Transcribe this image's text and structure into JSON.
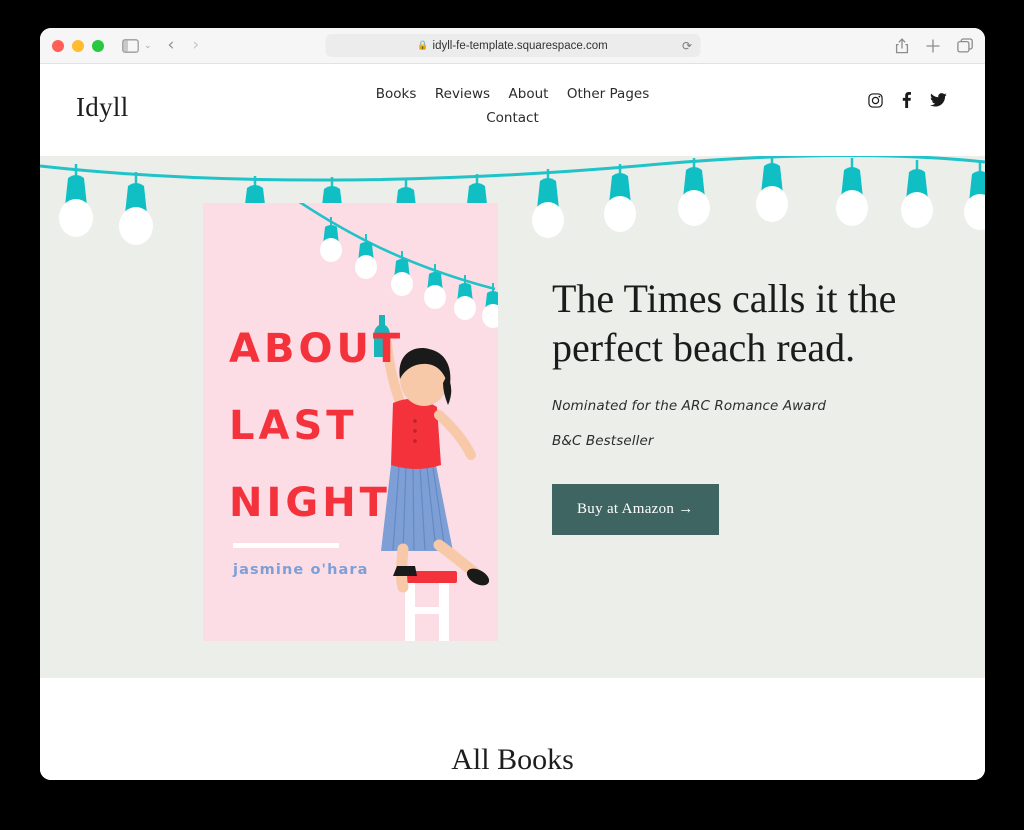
{
  "browser": {
    "url": "idyll-fe-template.squarespace.com",
    "lock_icon": "lock-icon",
    "reload_icon": "reload-icon",
    "sidebar_icon": "sidebar-toggle-icon",
    "sidebar_chevron": "chevron-down-icon",
    "back_arrow": "‹",
    "forward_arrow": "›",
    "share_icon": "share-icon",
    "new_tab_icon": "plus-icon",
    "tabs_icon": "tab-overview-icon",
    "traffic_lights": [
      "close",
      "minimize",
      "zoom"
    ]
  },
  "site": {
    "logo": "Idyll",
    "nav_row_1": [
      {
        "label": "Books"
      },
      {
        "label": "Reviews"
      },
      {
        "label": "About"
      },
      {
        "label": "Other Pages"
      }
    ],
    "nav_row_2": [
      {
        "label": "Contact"
      }
    ],
    "social": [
      {
        "name": "instagram-icon"
      },
      {
        "name": "facebook-icon"
      },
      {
        "name": "twitter-icon"
      }
    ]
  },
  "hero": {
    "headline": "The Times calls it the perfect beach read.",
    "subtitle_1": "Nominated for the ARC Romance Award",
    "subtitle_2": "B&C Bestseller",
    "cta_label": "Buy at Amazon →",
    "background_color": "#eceeea",
    "cta_color": "#3f6562"
  },
  "book_cover": {
    "title_line_1": "ABOUT",
    "title_line_2": "LAST",
    "title_line_3": "NIGHT",
    "author": "jasmine o'hara",
    "background_color": "#fcdde6",
    "title_color": "#f4323c",
    "author_color": "#7d9fd6",
    "accent_teal": "#0fbfc4"
  },
  "sections": {
    "all_books_title": "All Books"
  }
}
